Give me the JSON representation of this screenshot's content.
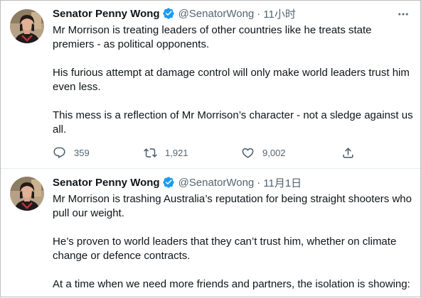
{
  "tweets": [
    {
      "author_name": "Senator Penny Wong",
      "handle": "@SenatorWong",
      "separator": "·",
      "time": "11小时",
      "paragraphs": [
        "Mr Morrison is treating leaders of other countries like he treats state premiers - as political opponents.",
        "His furious attempt at damage control will only make world leaders trust him even less.",
        "This mess is a reflection of Mr Morrison’s character - not a sledge against us all."
      ],
      "replies": "359",
      "retweets": "1,921",
      "likes": "9,002"
    },
    {
      "author_name": "Senator Penny Wong",
      "handle": "@SenatorWong",
      "separator": "·",
      "time": "11月1日",
      "paragraphs": [
        "Mr Morrison is trashing Australia’s reputation for being straight shooters who pull our weight.",
        "He’s proven to world leaders that they can’t trust him, whether on climate change or defence contracts.",
        "At a time when we need more friends and partners, the isolation is showing:"
      ]
    }
  ],
  "icons": {
    "verified": "verified-badge-icon",
    "more": "more-options-icon",
    "reply": "reply-icon",
    "retweet": "retweet-icon",
    "like": "heart-icon",
    "share": "share-icon"
  },
  "colors": {
    "verified": "#1d9bf0",
    "secondary_text": "#536471",
    "primary_text": "#0f1419",
    "divider": "#e6ecf0"
  }
}
